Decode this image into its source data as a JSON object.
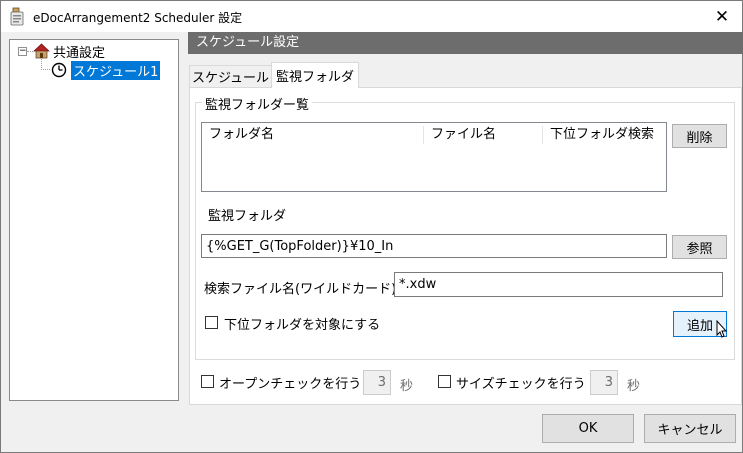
{
  "window": {
    "title": "eDocArrangement2 Scheduler 設定",
    "close_glyph": "✕"
  },
  "tree": {
    "items": [
      {
        "label": "共通設定",
        "expander": "−"
      },
      {
        "label": "スケジュール1"
      }
    ]
  },
  "section_header": "スケジュール設定",
  "tabs": [
    {
      "label": "スケジュール"
    },
    {
      "label": "監視フォルダ"
    }
  ],
  "monitor": {
    "group_title": "監視フォルダー覧",
    "list_columns": [
      "フォルダ名",
      "ファイル名",
      "下位フォルダ検索"
    ],
    "delete_label": "削除",
    "folder_label": "監視フォルダ",
    "folder_value": "{%GET_G(TopFolder)}¥10_In",
    "browse_label": "参照",
    "search_label": "検索ファイル名(ワイルドカード)",
    "search_value": "*.xdw",
    "subfolder_label": "下位フォルダを対象にする",
    "add_label": "追加"
  },
  "checks": {
    "open_label": "オープンチェックを行う",
    "open_value": "3",
    "open_unit": "秒",
    "size_label": "サイズチェックを行う",
    "size_value": "3",
    "size_unit": "秒"
  },
  "footer": {
    "ok_label": "OK",
    "cancel_label": "キャンセル"
  }
}
